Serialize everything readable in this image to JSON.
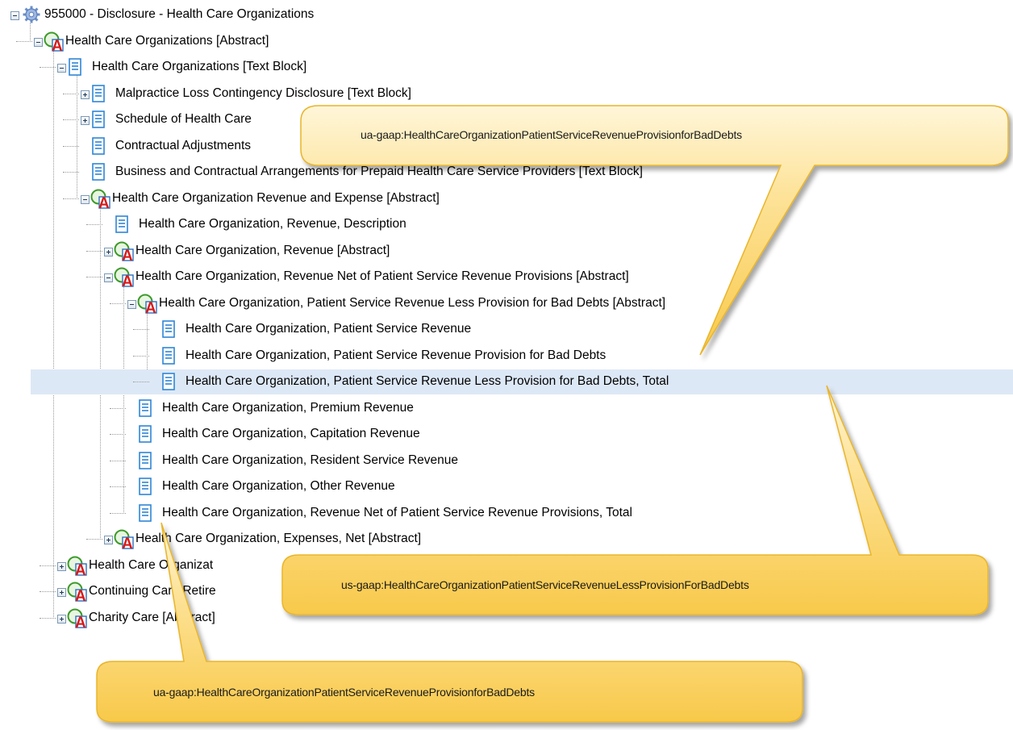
{
  "tree": [
    {
      "label": "955000 - Disclosure - Health Care Organizations",
      "icon": "gear-icon",
      "expander": "minus"
    },
    {
      "label": "Health Care Organizations [Abstract]",
      "icon": "abstract-icon",
      "expander": "minus"
    },
    {
      "label": "Health Care Organizations [Text Block]",
      "icon": "document-icon",
      "expander": "minus"
    },
    {
      "label": "Malpractice Loss Contingency Disclosure [Text Block]",
      "icon": "document-icon",
      "expander": "plus"
    },
    {
      "label": "Schedule of Health Care",
      "icon": "document-icon",
      "expander": "plus"
    },
    {
      "label": "Contractual Adjustments",
      "icon": "document-icon",
      "expander": "none"
    },
    {
      "label": "Business and Contractual Arrangements for Prepaid Health Care Service Providers [Text Block]",
      "icon": "document-icon",
      "expander": "none"
    },
    {
      "label": "Health Care Organization Revenue and Expense [Abstract]",
      "icon": "abstract-icon",
      "expander": "minus"
    },
    {
      "label": "Health Care Organization, Revenue, Description",
      "icon": "document-icon",
      "expander": "none"
    },
    {
      "label": "Health Care Organization, Revenue [Abstract]",
      "icon": "abstract-icon",
      "expander": "plus"
    },
    {
      "label": "Health Care Organization, Revenue Net of Patient Service Revenue Provisions [Abstract]",
      "icon": "abstract-icon",
      "expander": "minus"
    },
    {
      "label": "Health Care Organization, Patient Service Revenue Less Provision for Bad Debts [Abstract]",
      "icon": "abstract-icon",
      "expander": "minus"
    },
    {
      "label": "Health Care Organization, Patient Service Revenue",
      "icon": "document-icon",
      "expander": "none"
    },
    {
      "label": "Health Care Organization, Patient Service Revenue Provision for Bad Debts",
      "icon": "document-icon",
      "expander": "none"
    },
    {
      "label": "Health Care Organization, Patient Service Revenue Less Provision for Bad Debts, Total",
      "icon": "document-icon",
      "expander": "none",
      "selected": true
    },
    {
      "label": "Health Care Organization, Premium Revenue",
      "icon": "document-icon",
      "expander": "none"
    },
    {
      "label": "Health Care Organization, Capitation Revenue",
      "icon": "document-icon",
      "expander": "none"
    },
    {
      "label": "Health Care Organization, Resident Service Revenue",
      "icon": "document-icon",
      "expander": "none"
    },
    {
      "label": "Health Care Organization, Other Revenue",
      "icon": "document-icon",
      "expander": "none"
    },
    {
      "label": "Health Care Organization, Revenue Net of Patient Service Revenue Provisions, Total",
      "icon": "document-icon",
      "expander": "none"
    },
    {
      "label": "Health Care Organization, Expenses, Net [Abstract]",
      "icon": "abstract-icon",
      "expander": "plus"
    },
    {
      "label": "Health Care Organizat",
      "icon": "abstract-icon",
      "expander": "plus"
    },
    {
      "label": "Continuing Care Retire",
      "icon": "abstract-icon",
      "expander": "plus"
    },
    {
      "label": "Charity Care [Abstract]",
      "icon": "abstract-icon",
      "expander": "plus"
    }
  ],
  "callouts": [
    {
      "text": "ua-gaap:HealthCareOrganizationPatientServiceRevenueProvisionforBadDebts"
    },
    {
      "text": "us-gaap:HealthCareOrganizationPatientServiceRevenueLessProvisionForBadDebts"
    },
    {
      "text": "ua-gaap:HealthCareOrganizationPatientServiceRevenueProvisionforBadDebts"
    }
  ],
  "colors": {
    "selection": "#dde8f6",
    "callout_fill": "#fdd878",
    "callout_border": "#e9b52b",
    "document_icon": "#2e86d6",
    "abstract_icon_text": "#d61a1a"
  }
}
